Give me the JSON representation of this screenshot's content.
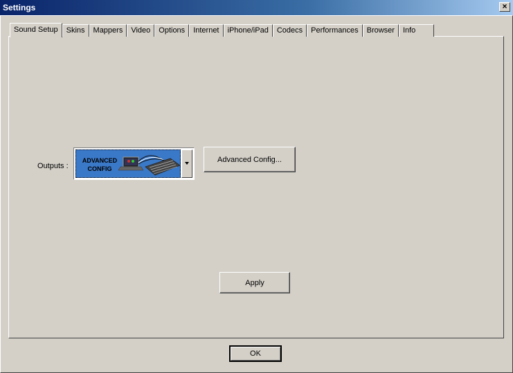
{
  "window": {
    "title": "Settings",
    "close_label": "×"
  },
  "tabs": [
    {
      "label": "Sound Setup",
      "active": true
    },
    {
      "label": "Skins"
    },
    {
      "label": "Mappers"
    },
    {
      "label": "Video"
    },
    {
      "label": "Options"
    },
    {
      "label": "Internet"
    },
    {
      "label": "iPhone/iPad"
    },
    {
      "label": "Codecs"
    },
    {
      "label": "Performances"
    },
    {
      "label": "Browser"
    },
    {
      "label": "Info"
    }
  ],
  "sound_setup": {
    "outputs_label": "Outputs :",
    "outputs_selected": "ADVANCED CONFIG",
    "advanced_config_button": "Advanced Config...",
    "apply_button": "Apply"
  },
  "footer": {
    "ok_button": "OK"
  },
  "colors": {
    "face": "#d4d0c8",
    "title_start": "#0a246a",
    "title_end": "#a6caf0",
    "combo_background": "#3a78c8"
  },
  "icons": {
    "combo_image": "laptop-and-mixer-icon",
    "dropdown": "chevron-down-icon"
  }
}
